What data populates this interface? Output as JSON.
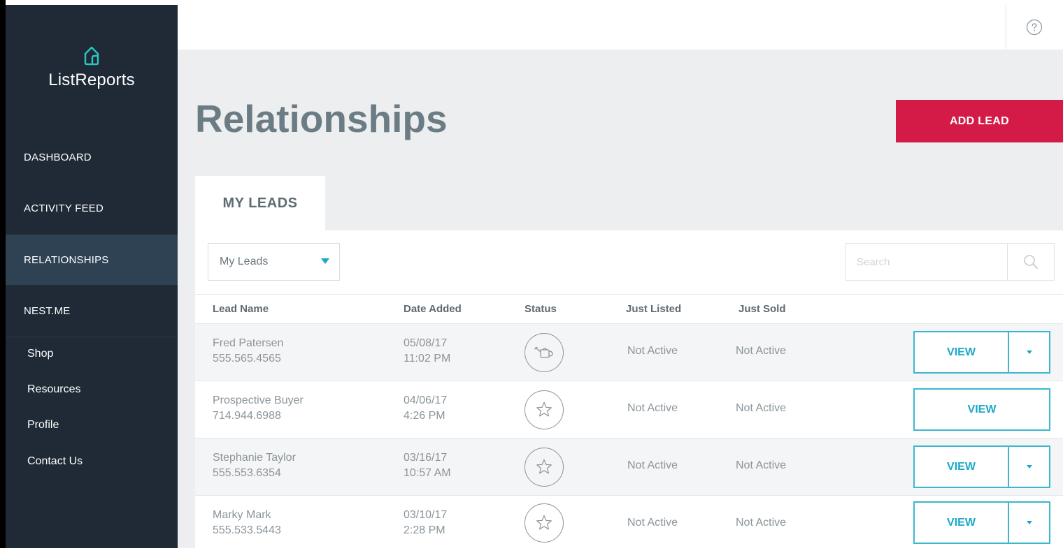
{
  "app": {
    "name": "ListReports",
    "logo_icon": "house-outline-icon"
  },
  "sidebar": {
    "nav": [
      {
        "label": "DASHBOARD"
      },
      {
        "label": "ACTIVITY FEED"
      },
      {
        "label": "RELATIONSHIPS",
        "active": true
      },
      {
        "label": "NEST.ME"
      }
    ],
    "sub": [
      {
        "label": "Shop"
      },
      {
        "label": "Resources"
      },
      {
        "label": "Profile"
      },
      {
        "label": "Contact Us"
      }
    ]
  },
  "topbar": {
    "help_icon": "question-circle-icon"
  },
  "page": {
    "title": "Relationships",
    "add_button": "ADD LEAD"
  },
  "tabs": [
    {
      "label": "MY LEADS",
      "active": true
    }
  ],
  "filter": {
    "selected": "My Leads"
  },
  "search": {
    "placeholder": "Search",
    "value": ""
  },
  "table": {
    "headers": [
      "Lead Name",
      "Date Added",
      "Status",
      "Just Listed",
      "Just Sold"
    ],
    "rows": [
      {
        "name": "Fred Patersen",
        "phone": "555.565.4565",
        "date": "05/08/17",
        "time": "11:02 PM",
        "status_icon": "watering-can-icon",
        "just_listed": "Not Active",
        "just_sold": "Not Active",
        "action": "VIEW",
        "has_dropdown": true
      },
      {
        "name": "Prospective Buyer",
        "phone": "714.944.6988",
        "date": "04/06/17",
        "time": "4:26 PM",
        "status_icon": "star-icon",
        "just_listed": "Not Active",
        "just_sold": "Not Active",
        "action": "VIEW",
        "has_dropdown": false
      },
      {
        "name": "Stephanie Taylor",
        "phone": "555.553.6354",
        "date": "03/16/17",
        "time": "10:57 AM",
        "status_icon": "star-icon",
        "just_listed": "Not Active",
        "just_sold": "Not Active",
        "action": "VIEW",
        "has_dropdown": true
      },
      {
        "name": "Marky Mark",
        "phone": "555.533.5443",
        "date": "03/10/17",
        "time": "2:28 PM",
        "status_icon": "star-icon",
        "just_listed": "Not Active",
        "just_sold": "Not Active",
        "action": "VIEW",
        "has_dropdown": true
      }
    ]
  },
  "colors": {
    "sidebar_bg": "#1f2a36",
    "sidebar_active": "#2f4254",
    "accent": "#1aa8c8",
    "primary_button": "#d41b47",
    "page_bg": "#eceef0"
  }
}
